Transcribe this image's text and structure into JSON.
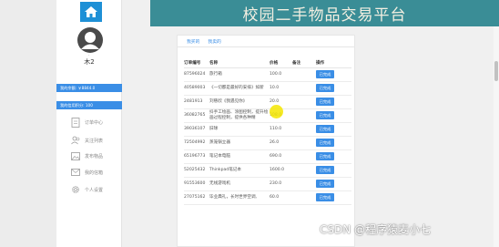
{
  "header": {
    "title": "校园二手物品交易平台"
  },
  "sidebar": {
    "username": "木2",
    "username_dot": "·",
    "balance_label": "我的余额: ￥8844.0",
    "credit_label": "我的信用积分: 100",
    "menu": [
      {
        "label": "订单中心",
        "icon": "document-icon"
      },
      {
        "label": "关注列表",
        "icon": "users-icon"
      },
      {
        "label": "发布物品",
        "icon": "image-icon"
      },
      {
        "label": "我的信箱",
        "icon": "mail-icon"
      },
      {
        "label": "个人设置",
        "icon": "gear-icon"
      }
    ]
  },
  "tabs": [
    {
      "label": "我买的"
    },
    {
      "label": "我卖的"
    }
  ],
  "table": {
    "headers": [
      "订单编号",
      "名称",
      "价格",
      "备注",
      "操作"
    ],
    "action_label": "已完成",
    "rows": [
      {
        "id": "87596024",
        "name": "旅行箱",
        "price": "100.0",
        "note": ""
      },
      {
        "id": "40589003",
        "name": "《一切都是最好的安排》如新",
        "price": "10.0",
        "note": ""
      },
      {
        "id": "2481913",
        "name": "刘慈欣《我遇见你》",
        "price": "20.0",
        "note": ""
      },
      {
        "id": "36082765",
        "name": "抖手工绘画、涂图控制，提升绘画过程控制，提供各种精",
        "price": "108.0",
        "note": ""
      },
      {
        "id": "39036107",
        "name": "旧球",
        "price": "110.0",
        "note": ""
      },
      {
        "id": "72504992",
        "name": "蒸笼锅立器",
        "price": "26.0",
        "note": ""
      },
      {
        "id": "65196773",
        "name": "笔记本电脑",
        "price": "690.0",
        "note": ""
      },
      {
        "id": "52025432",
        "name": "Thinkpad笔记本",
        "price": "1600.0",
        "note": ""
      },
      {
        "id": "91553600",
        "name": "无线游戏机",
        "price": "230.0",
        "note": ""
      },
      {
        "id": "27075162",
        "name": "毕业典礼，长时世界空调,",
        "price": "60.0",
        "note": ""
      }
    ]
  },
  "watermark": "CSDN @程序猿麦小七",
  "colors": {
    "accent": "#3a8ee6",
    "banner": "#3a8d96",
    "logo": "#1e90d6"
  }
}
